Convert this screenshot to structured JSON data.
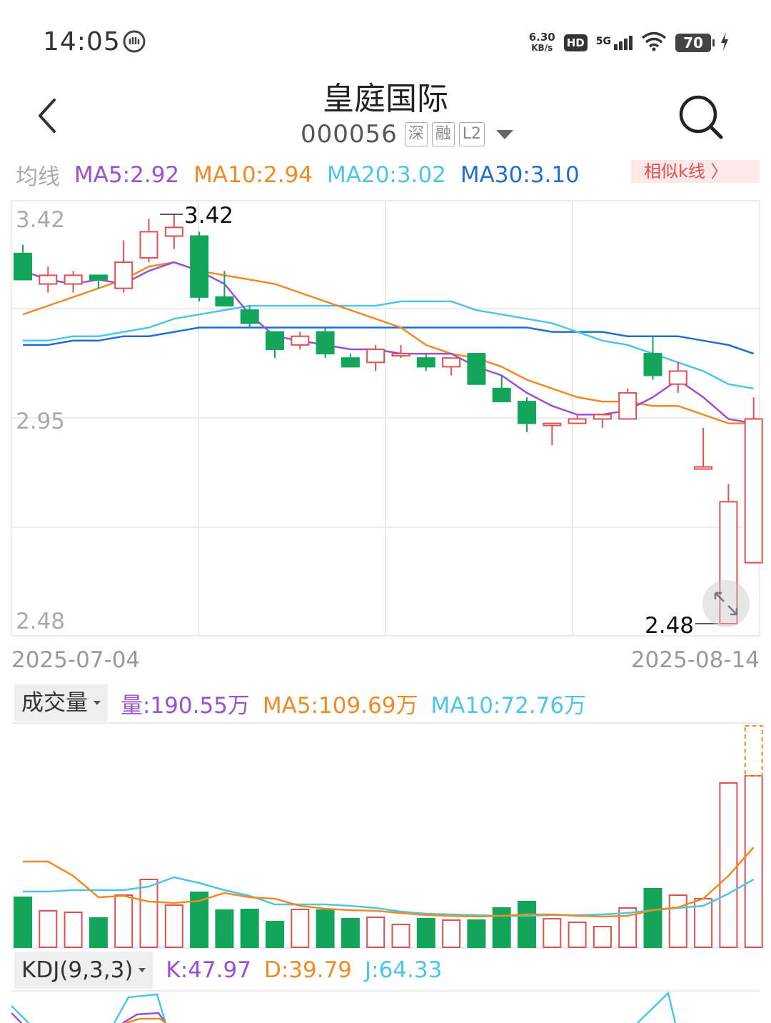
{
  "status_bar": {
    "time": "14:05",
    "net_speed_value": "6.30",
    "net_speed_unit": "KB/s",
    "hd": "HD",
    "signal": "5G",
    "battery": "70"
  },
  "header": {
    "title": "皇庭国际",
    "code": "000056",
    "tags": [
      "深",
      "融",
      "L2"
    ]
  },
  "ma_row": {
    "label": "均线",
    "ma5": "MA5:2.92",
    "ma10": "MA10:2.94",
    "ma20": "MA20:3.02",
    "ma30": "MA30:3.10",
    "similar_k": "相似k线 〉"
  },
  "colors": {
    "up": "#e05050",
    "down": "#13a55a",
    "ma5": "#9b4fd6",
    "ma10": "#f08a24",
    "ma20": "#4cc6e6",
    "ma30": "#1f6fd0"
  },
  "price_axis": {
    "top_label": "3.42",
    "mid_label": "2.95",
    "bottom_label": "2.48",
    "high_marker": "3.42",
    "low_marker": "2.48",
    "start_date": "2025-07-04",
    "end_date": "2025-08-14"
  },
  "volume_row": {
    "selector": "成交量",
    "vol": "量:190.55万",
    "ma5": "MA5:109.69万",
    "ma10": "MA10:72.76万"
  },
  "kdj_row": {
    "selector": "KDJ(9,3,3)",
    "k": "K:47.97",
    "d": "D:39.79",
    "j": "J:64.33"
  },
  "chart_data": {
    "type": "candlestick",
    "y_range": [
      2.48,
      3.42
    ],
    "candles": [
      {
        "o": 3.33,
        "h": 3.35,
        "l": 3.27,
        "c": 3.27
      },
      {
        "o": 3.26,
        "h": 3.3,
        "l": 3.24,
        "c": 3.28
      },
      {
        "o": 3.26,
        "h": 3.29,
        "l": 3.24,
        "c": 3.28
      },
      {
        "o": 3.28,
        "h": 3.28,
        "l": 3.25,
        "c": 3.27
      },
      {
        "o": 3.25,
        "h": 3.36,
        "l": 3.24,
        "c": 3.31
      },
      {
        "o": 3.32,
        "h": 3.41,
        "l": 3.31,
        "c": 3.38
      },
      {
        "o": 3.37,
        "h": 3.42,
        "l": 3.34,
        "c": 3.39
      },
      {
        "o": 3.37,
        "h": 3.38,
        "l": 3.22,
        "c": 3.23
      },
      {
        "o": 3.23,
        "h": 3.29,
        "l": 3.21,
        "c": 3.21
      },
      {
        "o": 3.2,
        "h": 3.21,
        "l": 3.16,
        "c": 3.17
      },
      {
        "o": 3.15,
        "h": 3.15,
        "l": 3.09,
        "c": 3.11
      },
      {
        "o": 3.12,
        "h": 3.15,
        "l": 3.11,
        "c": 3.14
      },
      {
        "o": 3.15,
        "h": 3.16,
        "l": 3.09,
        "c": 3.1
      },
      {
        "o": 3.09,
        "h": 3.1,
        "l": 3.07,
        "c": 3.07
      },
      {
        "o": 3.08,
        "h": 3.12,
        "l": 3.06,
        "c": 3.11
      },
      {
        "o": 3.1,
        "h": 3.12,
        "l": 3.09,
        "c": 3.1
      },
      {
        "o": 3.09,
        "h": 3.1,
        "l": 3.06,
        "c": 3.07
      },
      {
        "o": 3.07,
        "h": 3.09,
        "l": 3.05,
        "c": 3.09
      },
      {
        "o": 3.1,
        "h": 3.1,
        "l": 3.03,
        "c": 3.03
      },
      {
        "o": 3.02,
        "h": 3.05,
        "l": 2.99,
        "c": 2.99
      },
      {
        "o": 2.99,
        "h": 3.0,
        "l": 2.92,
        "c": 2.94
      },
      {
        "o": 2.94,
        "h": 2.94,
        "l": 2.89,
        "c": 2.94
      },
      {
        "o": 2.94,
        "h": 2.96,
        "l": 2.94,
        "c": 2.95
      },
      {
        "o": 2.95,
        "h": 2.96,
        "l": 2.93,
        "c": 2.96
      },
      {
        "o": 2.95,
        "h": 3.02,
        "l": 2.95,
        "c": 3.01
      },
      {
        "o": 3.1,
        "h": 3.14,
        "l": 3.04,
        "c": 3.05
      },
      {
        "o": 3.03,
        "h": 3.08,
        "l": 3.01,
        "c": 3.06
      },
      {
        "o": 2.84,
        "h": 2.93,
        "l": 2.84,
        "c": 2.84
      },
      {
        "o": 2.48,
        "h": 2.8,
        "l": 2.48,
        "c": 2.76
      },
      {
        "o": 2.62,
        "h": 3.0,
        "l": 2.62,
        "c": 2.95
      }
    ],
    "ma5": [
      3.29,
      3.27,
      3.26,
      3.27,
      3.26,
      3.29,
      3.31,
      3.29,
      3.26,
      3.19,
      3.14,
      3.13,
      3.12,
      3.11,
      3.11,
      3.1,
      3.1,
      3.1,
      3.07,
      3.05,
      3.01,
      2.98,
      2.96,
      2.96,
      2.97,
      3.0,
      3.04,
      3.0,
      2.95,
      2.94
    ],
    "ma10": [
      3.19,
      3.21,
      3.23,
      3.25,
      3.27,
      3.3,
      3.31,
      3.29,
      3.28,
      3.27,
      3.26,
      3.24,
      3.22,
      3.2,
      3.18,
      3.16,
      3.12,
      3.1,
      3.09,
      3.07,
      3.04,
      3.02,
      3.0,
      2.99,
      2.99,
      2.98,
      2.98,
      2.96,
      2.94,
      2.94
    ],
    "ma20": [
      3.13,
      3.13,
      3.14,
      3.14,
      3.15,
      3.16,
      3.18,
      3.19,
      3.2,
      3.21,
      3.21,
      3.21,
      3.21,
      3.21,
      3.21,
      3.22,
      3.22,
      3.22,
      3.2,
      3.19,
      3.18,
      3.17,
      3.15,
      3.13,
      3.12,
      3.1,
      3.08,
      3.06,
      3.03,
      3.02
    ],
    "ma30": [
      3.12,
      3.12,
      3.13,
      3.13,
      3.14,
      3.14,
      3.15,
      3.16,
      3.16,
      3.16,
      3.16,
      3.16,
      3.16,
      3.16,
      3.16,
      3.16,
      3.16,
      3.16,
      3.16,
      3.16,
      3.16,
      3.15,
      3.15,
      3.15,
      3.14,
      3.14,
      3.14,
      3.13,
      3.12,
      3.1
    ],
    "volume": [
      70,
      51,
      49,
      41,
      73,
      95,
      59,
      77,
      52,
      53,
      36,
      53,
      52,
      40,
      42,
      32,
      40,
      38,
      38,
      55,
      64,
      40,
      35,
      29,
      55,
      82,
      73,
      68,
      230,
      240
    ],
    "volume_ghost_top": 310,
    "volume_ma5": [
      120,
      120,
      100,
      70,
      72,
      64,
      62,
      65,
      76,
      70,
      68,
      58,
      54,
      52,
      51,
      48,
      45,
      44,
      43,
      44,
      46,
      46,
      44,
      43,
      44,
      52,
      56,
      68,
      100,
      140
    ],
    "volume_ma10": [
      78,
      78,
      80,
      80,
      80,
      85,
      98,
      90,
      80,
      72,
      60,
      60,
      60,
      58,
      55,
      50,
      47,
      46,
      45,
      44,
      44,
      45,
      45,
      46,
      48,
      52,
      55,
      58,
      75,
      95
    ]
  }
}
